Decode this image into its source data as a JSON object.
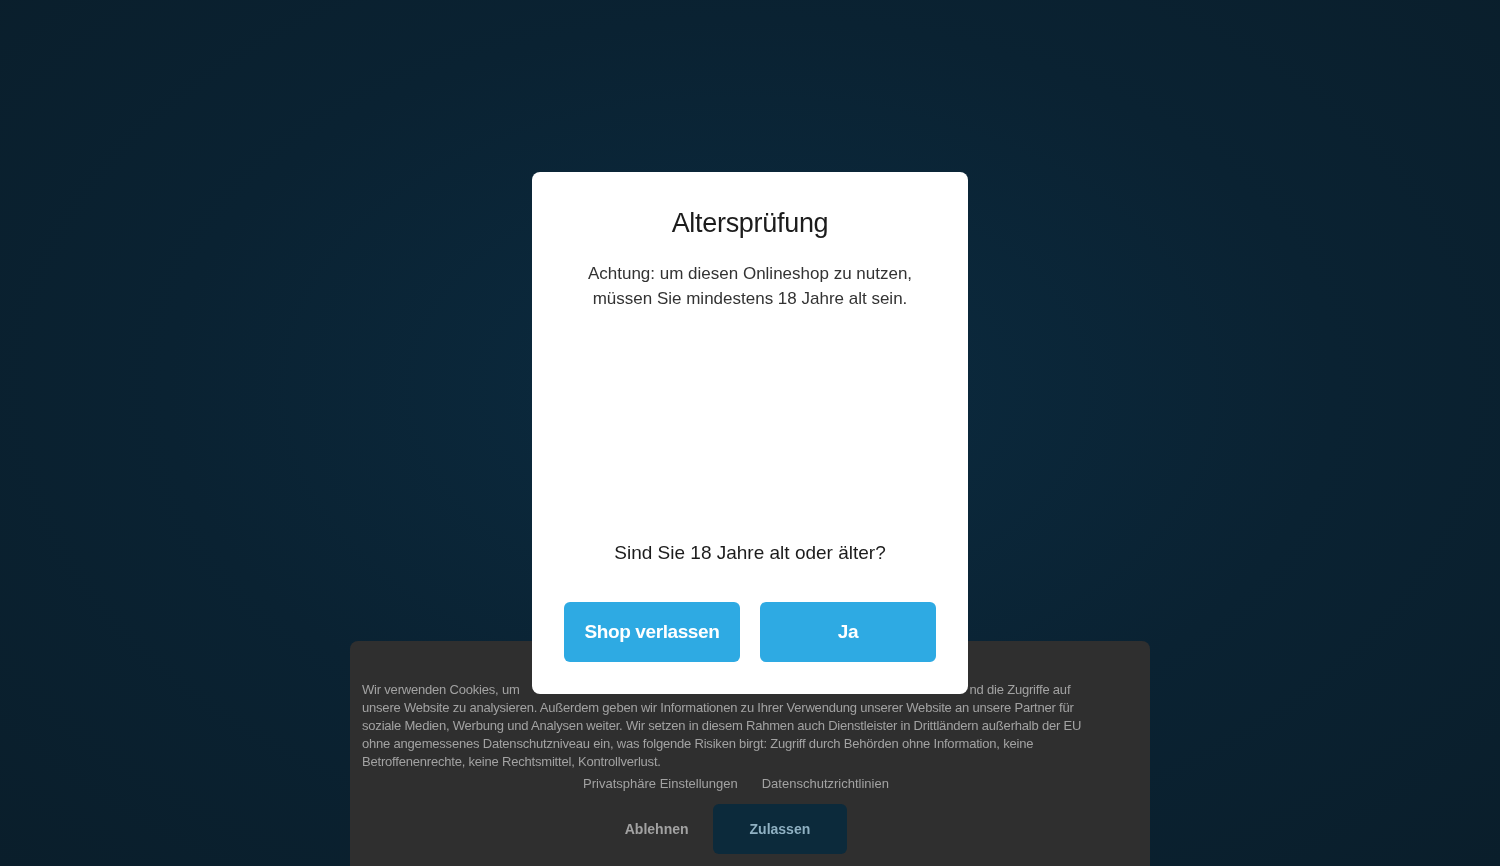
{
  "cookie_banner": {
    "text_start": "Wir verwenden Cookies, um",
    "text_rest": "nd die Zugriffe auf unsere Website zu analysieren. Außerdem geben wir Informationen zu Ihrer Verwendung unserer Website an unsere Partner für soziale Medien, Werbung und Analysen weiter. Wir setzen in diesem Rahmen auch Dienstleister in Drittländern außerhalb der EU ohne angemessenes Datenschutzniveau ein, was folgende Risiken birgt: Zugriff durch Behörden ohne Information, keine Betroffenenrechte, keine Rechtsmittel, Kontrollverlust.",
    "links": [
      "Privatsphäre Einstellungen",
      "Datenschutzrichtlinien"
    ],
    "buttons": [
      {
        "label": "Ablehnen",
        "kind": "plain"
      },
      {
        "label": "Zulassen",
        "kind": "filled"
      }
    ]
  },
  "age_dialog": {
    "title": "Altersprüfung",
    "message": "Achtung: um diesen Onlineshop zu nutzen, müssen Sie mindestens 18 Jahre alt sein.",
    "question": "Sind Sie 18 Jahre alt oder älter?",
    "buttons": [
      {
        "label": "Shop verlassen"
      },
      {
        "label": "Ja"
      }
    ]
  }
}
